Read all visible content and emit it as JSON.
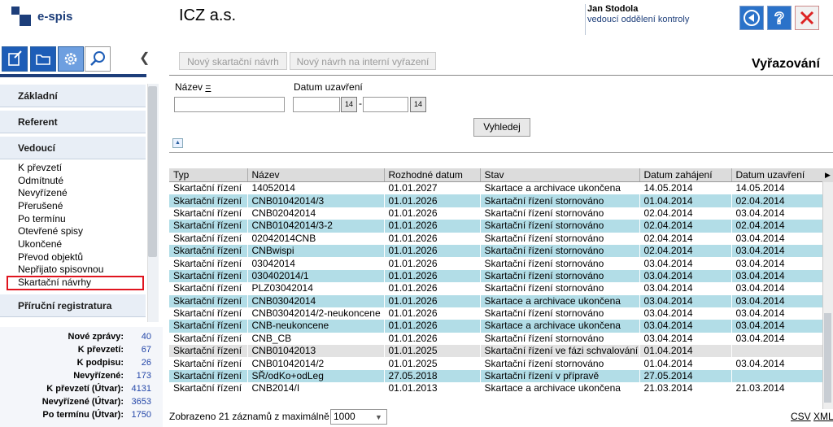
{
  "app": {
    "logo_text": "e-spis",
    "org_name": "ICZ a.s."
  },
  "user": {
    "name": "Jan  Stodola",
    "role": "vedoucí oddělení kontroly"
  },
  "header_buttons": [
    "back-icon",
    "help-icon",
    "close-icon"
  ],
  "toolbar_icons": [
    "new-document-icon",
    "folder-icon",
    "gear-icon",
    "search-icon"
  ],
  "sidebar": {
    "sections": {
      "zakladni": "Základní",
      "referent": "Referent",
      "vedouci": "Vedoucí",
      "prirucni": "Příruční registratura"
    },
    "vedouci_items": [
      "K převzetí",
      "Odmítnuté",
      "Nevyřízené",
      "Přerušené",
      "Po termínu",
      "Otevřené spisy",
      "Ukončené",
      "Převod objektů",
      "Nepřijato spisovnou",
      "Skartační návrhy"
    ]
  },
  "stats": [
    {
      "label": "Nové zprávy:",
      "value": "40"
    },
    {
      "label": "K převzetí:",
      "value": "67"
    },
    {
      "label": "K podpisu:",
      "value": "26"
    },
    {
      "label": "Nevyřízené:",
      "value": "173"
    },
    {
      "label": "K převzetí (Útvar):",
      "value": "4131"
    },
    {
      "label": "Nevyřízené (Útvar):",
      "value": "3653"
    },
    {
      "label": "Po termínu (Útvar):",
      "value": "1750"
    }
  ],
  "actions": {
    "new_skart": "Nový skartační návrh",
    "new_internal": "Nový návrh na interní vyřazení"
  },
  "page_title": "Vyřazování",
  "filter": {
    "name_label": "Název",
    "name_op": "=",
    "date_label": "Datum uzavření",
    "date_sep": "-",
    "search_button": "Vyhledej",
    "calendar_label": "14"
  },
  "table": {
    "headers": [
      "Typ",
      "Název",
      "Rozhodné datum",
      "Stav",
      "Datum zahájení",
      "Datum uzavření"
    ],
    "rows": [
      [
        "Skartační řízení",
        "14052014",
        "01.01.2027",
        "Skartace a archivace ukončena",
        "14.05.2014",
        "14.05.2014",
        "white"
      ],
      [
        "Skartační řízení",
        "CNB01042014/3",
        "01.01.2026",
        "Skartační řízení stornováno",
        "01.04.2014",
        "02.04.2014",
        "blue"
      ],
      [
        "Skartační řízení",
        "CNB02042014",
        "01.01.2026",
        "Skartační řízení stornováno",
        "02.04.2014",
        "03.04.2014",
        "white"
      ],
      [
        "Skartační řízení",
        "CNB01042014/3-2",
        "01.01.2026",
        "Skartační řízení stornováno",
        "02.04.2014",
        "02.04.2014",
        "blue"
      ],
      [
        "Skartační řízení",
        "02042014CNB",
        "01.01.2026",
        "Skartační řízení stornováno",
        "02.04.2014",
        "03.04.2014",
        "white"
      ],
      [
        "Skartační řízení",
        "CNBwispi",
        "01.01.2026",
        "Skartační řízení stornováno",
        "02.04.2014",
        "03.04.2014",
        "blue"
      ],
      [
        "Skartační řízení",
        "03042014",
        "01.01.2026",
        "Skartační řízení stornováno",
        "03.04.2014",
        "03.04.2014",
        "white"
      ],
      [
        "Skartační řízení",
        "030402014/1",
        "01.01.2026",
        "Skartační řízení stornováno",
        "03.04.2014",
        "03.04.2014",
        "blue"
      ],
      [
        "Skartační řízení",
        "PLZ03042014",
        "01.01.2026",
        "Skartační řízení stornováno",
        "03.04.2014",
        "03.04.2014",
        "white"
      ],
      [
        "Skartační řízení",
        "CNB03042014",
        "01.01.2026",
        "Skartace a archivace ukončena",
        "03.04.2014",
        "03.04.2014",
        "blue"
      ],
      [
        "Skartační řízení",
        "CNB03042014/2-neukoncene",
        "01.01.2026",
        "Skartační řízení stornováno",
        "03.04.2014",
        "03.04.2014",
        "white"
      ],
      [
        "Skartační řízení",
        "CNB-neukoncene",
        "01.01.2026",
        "Skartace a archivace ukončena",
        "03.04.2014",
        "03.04.2014",
        "blue"
      ],
      [
        "Skartační řízení",
        "CNB_CB",
        "01.01.2026",
        "Skartační řízení stornováno",
        "03.04.2014",
        "03.04.2014",
        "white"
      ],
      [
        "Skartační řízení",
        "CNB01042013",
        "01.01.2025",
        "Skartační řízení ve fázi schvalování",
        "01.04.2014",
        "",
        "gray"
      ],
      [
        "Skartační řízení",
        "CNB01042014/2",
        "01.01.2025",
        "Skartační řízení stornováno",
        "01.04.2014",
        "03.04.2014",
        "white"
      ],
      [
        "Skartační řízení",
        "SŘ/odKo+odLeg",
        "27.05.2018",
        "Skartační řízení v přípravě",
        "27.05.2014",
        "",
        "blue"
      ],
      [
        "Skartační řízení",
        "CNB2014/I",
        "01.01.2013",
        "Skartace a archivace ukončena",
        "21.03.2014",
        "21.03.2014",
        "white"
      ]
    ]
  },
  "footer": {
    "summary": "Zobrazeno 21 záznamů z maximálně",
    "page_size": "1000",
    "csv": "CSV",
    "xml": "XML"
  }
}
